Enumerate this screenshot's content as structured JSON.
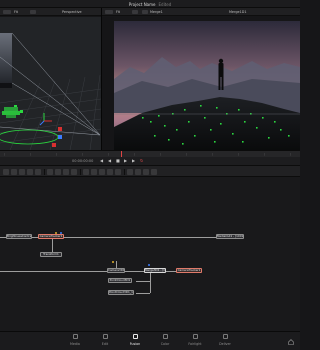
{
  "app": {
    "project_title": "Project Name",
    "edited_marker": "Edited"
  },
  "viewers": {
    "left": {
      "zoom": "Fit",
      "view": "Perspective"
    },
    "right": {
      "zoom": "Fit",
      "node_name": "Merge1",
      "image_name": "Merge1D1"
    }
  },
  "transport": {
    "timecode": "00:00:00:00"
  },
  "nodes": {
    "brightness": "BrightnessContrast1",
    "camera_tracker_top": "CameraTracker1",
    "transform": "Transform1",
    "media_out": "MediaOut1 - [1001]",
    "camera_3d": "Camera3D1",
    "merge_3d": "Merge3D1 - [Cmp]",
    "camera_tracker": "CameraTracker1",
    "point_cloud": "PointCloud3D1",
    "point_cloud_2": "PointCloud3D1_1"
  },
  "pages": [
    {
      "label": "Media",
      "icon": "media-icon"
    },
    {
      "label": "Edit",
      "icon": "edit-icon"
    },
    {
      "label": "Fusion",
      "icon": "fusion-icon",
      "active": true
    },
    {
      "label": "Color",
      "icon": "color-icon"
    },
    {
      "label": "Fairlight",
      "icon": "fairlight-icon"
    },
    {
      "label": "Deliver",
      "icon": "deliver-icon"
    }
  ],
  "colors": {
    "accent_red": "#e04444",
    "tracker_green": "#2bd840",
    "tracker_red": "#d83030",
    "tracker_blue": "#3b7cff"
  }
}
